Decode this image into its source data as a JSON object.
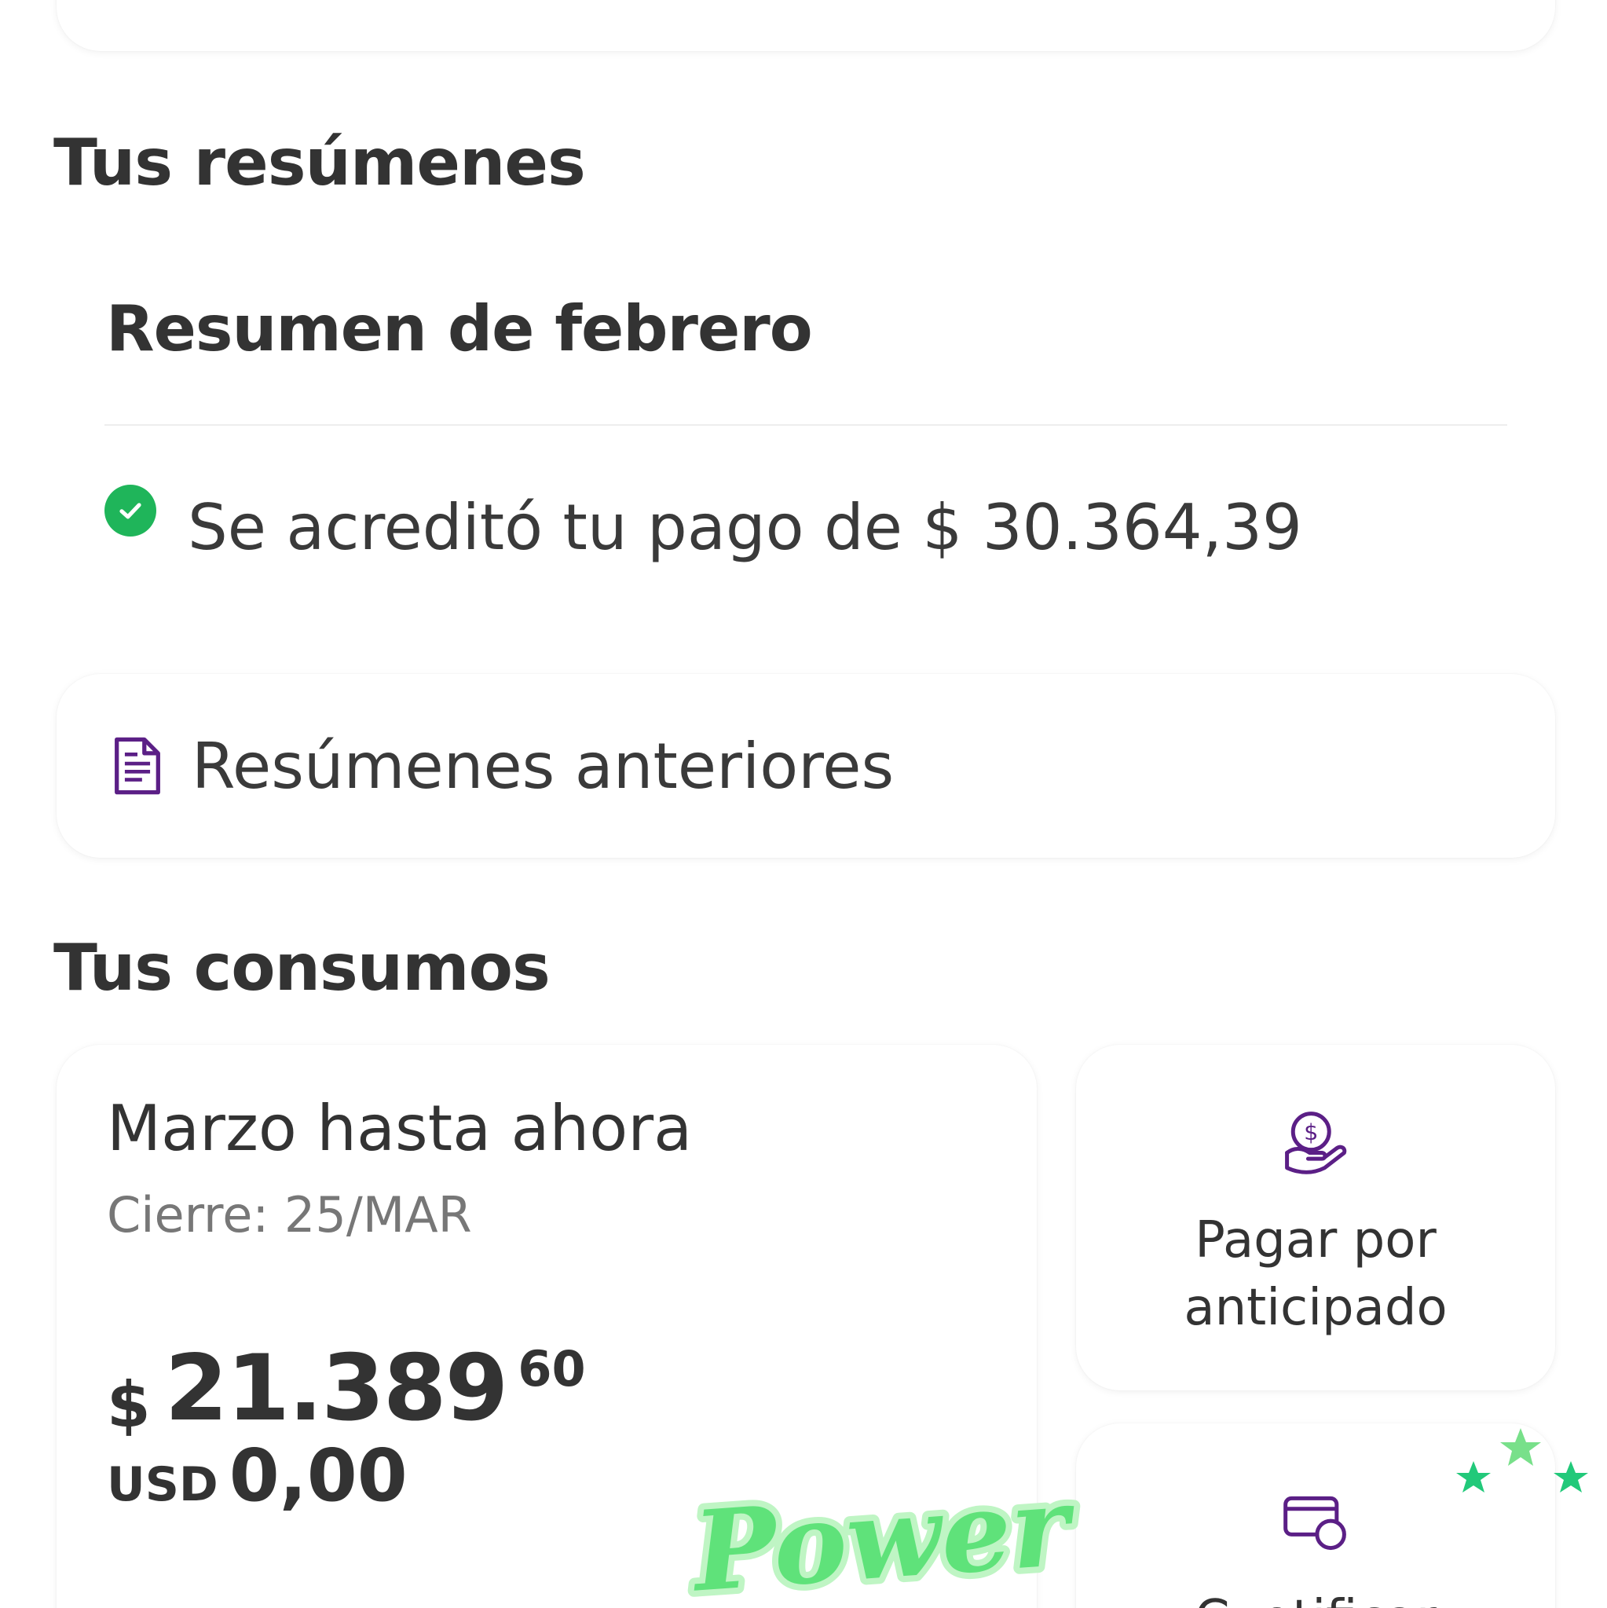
{
  "resumenes": {
    "title": "Tus resúmenes",
    "summary_title": "Resumen de febrero",
    "payment_text": "Se acreditó tu pago de $ 30.364,39",
    "previous_label": "Resúmenes anteriores"
  },
  "consumos": {
    "title": "Tus consumos",
    "month_title": "Marzo hasta ahora",
    "cierre": "Cierre: 25/MAR",
    "amount_currency": "$",
    "amount_integer": "21.389",
    "amount_decimals": "60",
    "usd_label": "USD",
    "usd_value": "0,00"
  },
  "actions": [
    {
      "label": "Pagar por anticipado",
      "icon": "pay-coin-hand-icon"
    },
    {
      "label": "Cuotificar",
      "icon": "card-icon"
    }
  ],
  "overlay": {
    "sticker_text": "Power",
    "sticker_icon": "stars-icon"
  },
  "colors": {
    "accent_purple": "#5b1f86",
    "success_green": "#1fb55a",
    "sticker_green": "#5fe27a"
  }
}
